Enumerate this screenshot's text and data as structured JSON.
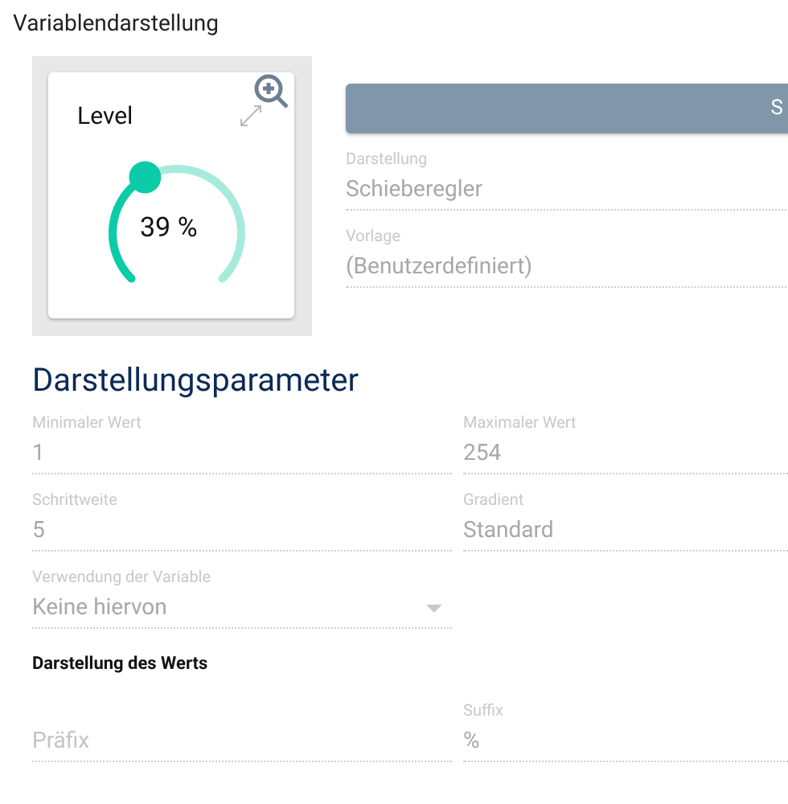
{
  "title": "Variablendarstellung",
  "preview": {
    "label": "Level",
    "reading": "39 %"
  },
  "button": {
    "label": "S"
  },
  "top_fields": [
    {
      "label": "Darstellung",
      "value": "Schieberegler"
    },
    {
      "label": "Vorlage",
      "value": "(Benutzerdefiniert)"
    }
  ],
  "section": {
    "title": "Darstellungsparameter"
  },
  "fields": [
    {
      "label": "Minimaler Wert",
      "value": "1",
      "kind": "text"
    },
    {
      "label": "Maximaler Wert",
      "value": "254",
      "kind": "text"
    },
    {
      "label": "Schrittweite",
      "value": "5",
      "kind": "text"
    },
    {
      "label": "Gradient",
      "value": "Standard",
      "kind": "text"
    },
    {
      "label": "Verwendung der Variable",
      "value": "Keine hiervon",
      "kind": "select"
    }
  ],
  "value_section": {
    "title": "Darstellung des Werts"
  },
  "value_fields": [
    {
      "placeholder": "Präfix"
    },
    {
      "label": "Suffix",
      "value": "%"
    }
  ]
}
